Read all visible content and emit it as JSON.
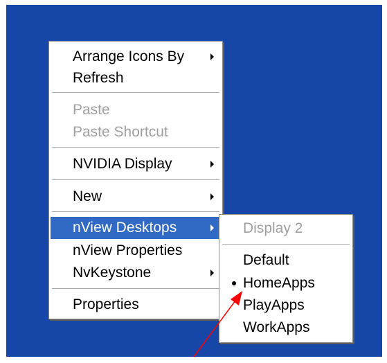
{
  "colors": {
    "desktop": "#1546a8",
    "menu_bg": "#ffffff",
    "highlight": "#316ac5",
    "disabled_text": "#a0a0a0",
    "annotation_arrow": "#ff0000"
  },
  "context_menu": {
    "items": [
      {
        "label": "Arrange Icons By",
        "has_submenu": true
      },
      {
        "label": "Refresh"
      },
      {
        "label": "Paste",
        "disabled": true
      },
      {
        "label": "Paste Shortcut",
        "disabled": true
      },
      {
        "label": "NVIDIA Display",
        "has_submenu": true
      },
      {
        "label": "New",
        "has_submenu": true
      },
      {
        "label": "nView Desktops",
        "has_submenu": true,
        "selected": true
      },
      {
        "label": "nView Properties"
      },
      {
        "label": "NvKeystone",
        "has_submenu": true
      },
      {
        "label": "Properties"
      }
    ]
  },
  "submenu": {
    "header": "Display 2",
    "items": [
      {
        "label": "Default"
      },
      {
        "label": "HomeApps",
        "checked": true
      },
      {
        "label": "PlayApps"
      },
      {
        "label": "WorkApps"
      }
    ]
  },
  "icons": {
    "submenu_arrow": "chevron-right-icon",
    "radio_bullet": "bullet-icon",
    "annotation": "red-arrow-icon"
  }
}
